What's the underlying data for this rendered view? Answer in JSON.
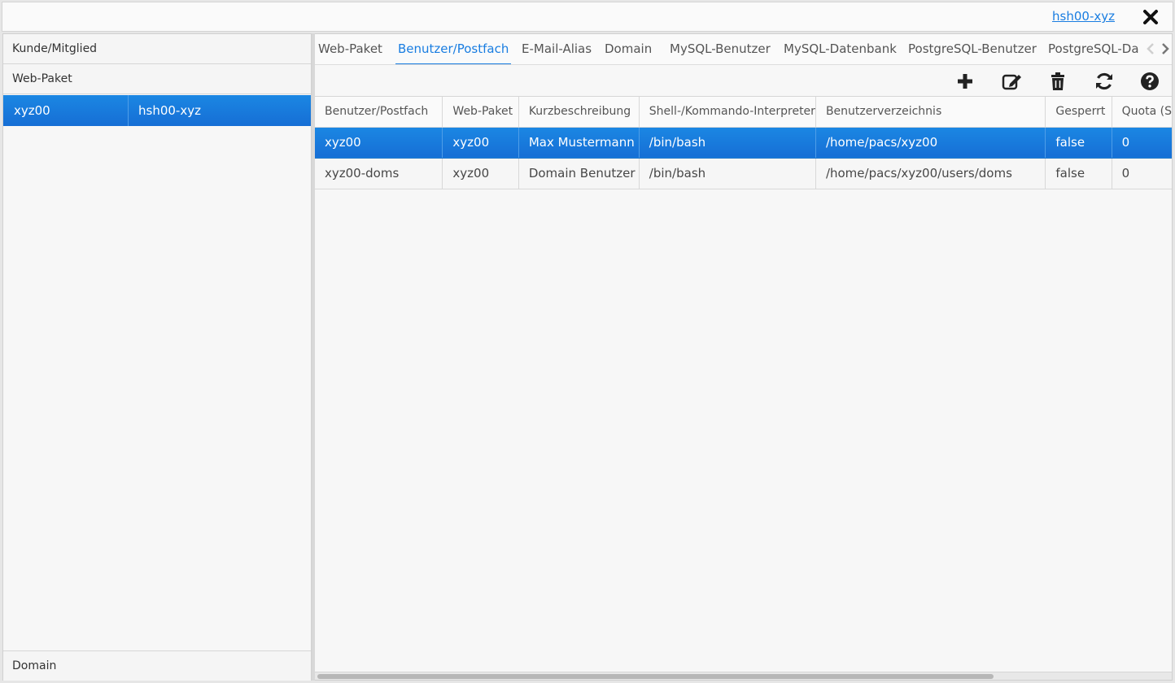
{
  "header": {
    "user_link": "hsh00-xyz",
    "close_icon": "close-icon"
  },
  "left_panel": {
    "sections": [
      "Kunde/Mitglied",
      "Web-Paket",
      "Domain"
    ],
    "selected_row": {
      "col1": "xyz00",
      "col2": "hsh00-xyz"
    }
  },
  "tabs": [
    {
      "label": "Web-Paket",
      "active": false
    },
    {
      "label": "Benutzer/Postfach",
      "active": true
    },
    {
      "label": "E-Mail-Alias",
      "active": false
    },
    {
      "label": "Domain",
      "active": false
    },
    {
      "label": "MySQL-Benutzer",
      "active": false
    },
    {
      "label": "MySQL-Datenbank",
      "active": false
    },
    {
      "label": "PostgreSQL-Benutzer",
      "active": false
    },
    {
      "label": "PostgreSQL-Da",
      "active": false
    }
  ],
  "toolbar": {
    "icons": [
      "add-icon",
      "edit-icon",
      "delete-icon",
      "refresh-icon",
      "help-icon"
    ]
  },
  "grid": {
    "columns": [
      "Benutzer/Postfach",
      "Web-Paket",
      "Kurzbeschreibung",
      "Shell-/Kommando-Interpreter",
      "Benutzerverzeichnis",
      "Gesperrt",
      "Quota (S"
    ],
    "rows": [
      [
        "xyz00",
        "xyz00",
        "Max Mustermann",
        "/bin/bash",
        "/home/pacs/xyz00",
        "false",
        "0"
      ],
      [
        "xyz00-doms",
        "xyz00",
        "Domain Benutzer",
        "/bin/bash",
        "/home/pacs/xyz00/users/doms",
        "false",
        "0"
      ]
    ],
    "selected_row": 0
  },
  "colors": {
    "accent": "#197de1",
    "selection": "#1676d8",
    "background": "#f7f7f7"
  }
}
